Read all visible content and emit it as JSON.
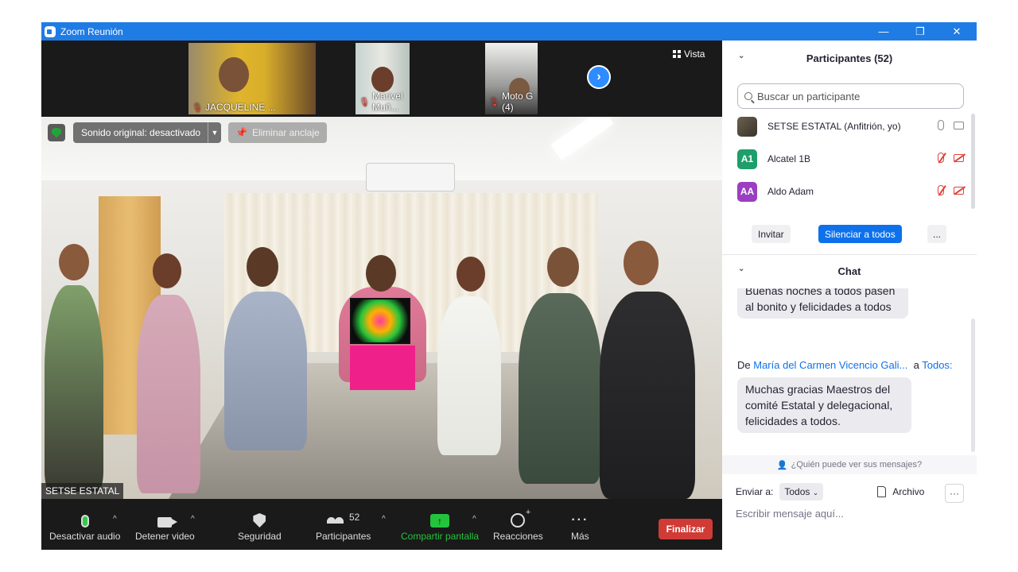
{
  "window": {
    "title": "Zoom Reunión",
    "minimize": "—",
    "restore": "❐",
    "close": "✕"
  },
  "thumbnails": [
    {
      "name": "JACQUELINE ..."
    },
    {
      "name": "Marivel Muñ..."
    },
    {
      "name": "Moto G (4)"
    }
  ],
  "vista_label": "Vista",
  "overlay": {
    "sound": "Sonido original: desactivado",
    "unpin": "Eliminar anclaje",
    "speaker": "SETSE ESTATAL"
  },
  "toolbar": {
    "audio": "Desactivar audio",
    "video": "Detener video",
    "security": "Seguridad",
    "participants": "Participantes",
    "participants_count": "52",
    "share": "Compartir pantalla",
    "reactions": "Reacciones",
    "more": "Más",
    "end": "Finalizar"
  },
  "participants_panel": {
    "title": "Participantes (52)",
    "search_placeholder": "Buscar un participante",
    "list": [
      {
        "name": "SETSE ESTATAL (Anfitrión, yo)",
        "initials": "",
        "color": "#5a5040"
      },
      {
        "name": "Alcatel 1B",
        "initials": "A1",
        "color": "#1e9e6a"
      },
      {
        "name": "Aldo Adam",
        "initials": "AA",
        "color": "#9b3fc2"
      }
    ],
    "invite": "Invitar",
    "mute_all": "Silenciar a todos",
    "more": "..."
  },
  "chat": {
    "title": "Chat",
    "message1": "Buenas noches a todos pasen al bonito y felicidades a todos",
    "from_prefix": "De",
    "from_name": "María del Carmen Vicencio Gali...",
    "to_prefix": "a",
    "to_name": "Todos:",
    "message2": "Muchas gracias Maestros del comité Estatal y delegacional, felicidades a todos.",
    "who_sees": "¿Quién puede ver sus mensajes?",
    "send_to_label": "Enviar a:",
    "send_to_value": "Todos",
    "file": "Archivo",
    "more": "···",
    "input_placeholder": "Escribir mensaje aquí..."
  },
  "colors": {
    "accent": "#1f7ce5",
    "share_green": "#23c43c",
    "end_red": "#d13b35",
    "link_blue": "#0e71eb"
  }
}
